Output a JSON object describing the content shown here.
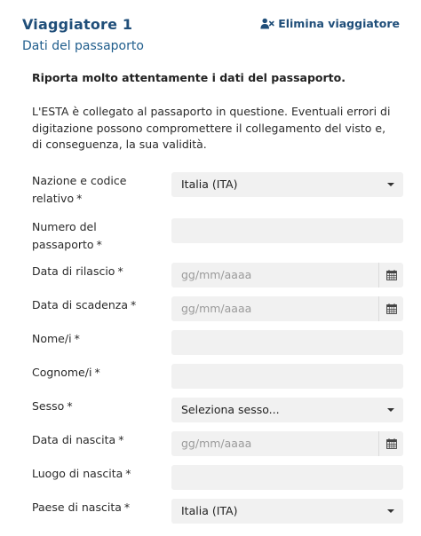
{
  "header": {
    "traveler_title": "Viaggiatore 1",
    "delete_label": "Elimina viaggiatore",
    "section_title": "Dati del passaporto"
  },
  "intro": {
    "lead": "Riporta molto attentamente i dati del passaporto.",
    "description": "L'ESTA è collegato al passaporto in questione. Eventuali errori di digitazione possono compromettere il collegamento del visto e, di conseguenza, la sua validità."
  },
  "required_mark": "*",
  "fields": {
    "nationality": {
      "label": "Nazione e codice relativo",
      "value": "Italia (ITA)"
    },
    "passport_number": {
      "label": "Numero del passaporto",
      "value": ""
    },
    "issue_date": {
      "label": "Data di rilascio",
      "placeholder": "gg/mm/aaaa"
    },
    "expiry_date": {
      "label": "Data di scadenza",
      "placeholder": "gg/mm/aaaa"
    },
    "first_name": {
      "label": "Nome/i",
      "value": ""
    },
    "last_name": {
      "label": "Cognome/i",
      "value": ""
    },
    "sex": {
      "label": "Sesso",
      "value": "Seleziona sesso..."
    },
    "birth_date": {
      "label": "Data di nascita",
      "placeholder": "gg/mm/aaaa"
    },
    "birth_place": {
      "label": "Luogo di nascita",
      "value": ""
    },
    "birth_country": {
      "label": "Paese di nascita",
      "value": "Italia (ITA)"
    }
  },
  "icons": {
    "delete": "user-remove-icon",
    "date": "calendar-icon",
    "select": "caret-down-icon"
  },
  "colors": {
    "title": "#1f4e79",
    "field_bg": "#f1f1f1",
    "placeholder": "#9a9a9a"
  }
}
